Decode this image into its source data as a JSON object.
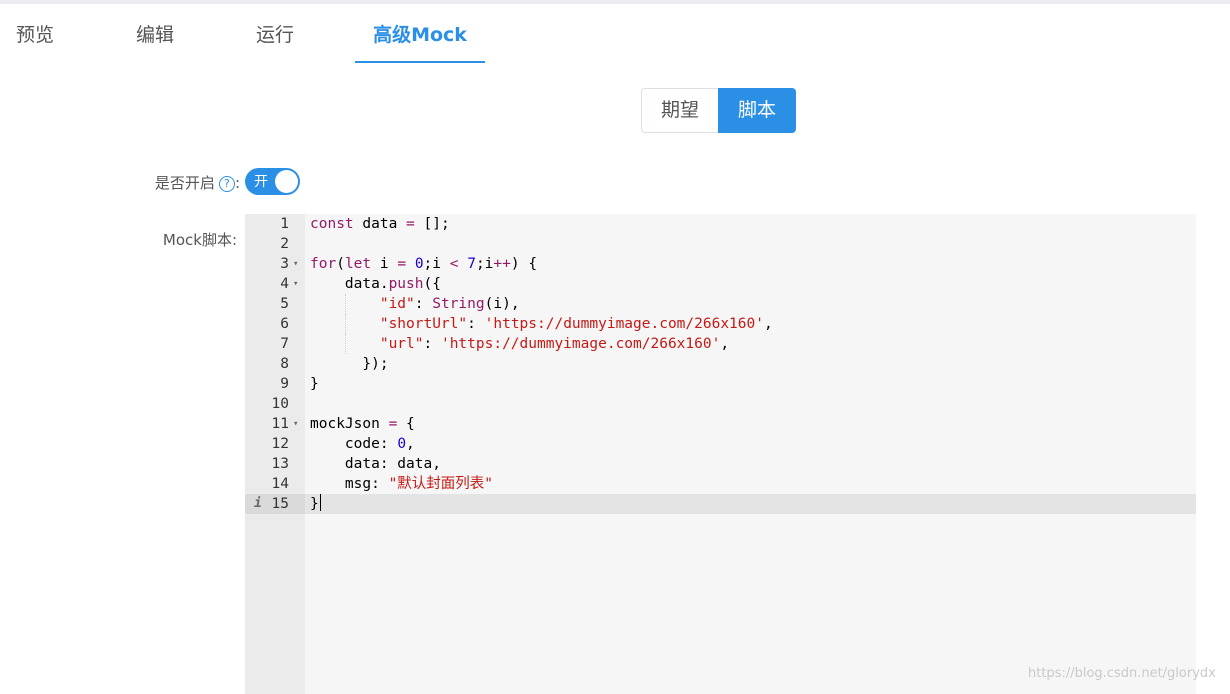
{
  "tabs": [
    {
      "label": "预览",
      "active": false
    },
    {
      "label": "编辑",
      "active": false
    },
    {
      "label": "运行",
      "active": false
    },
    {
      "label": "高级Mock",
      "active": true
    }
  ],
  "mode_toggle": {
    "left_label": "期望",
    "right_label": "脚本",
    "selected": "脚本"
  },
  "form": {
    "enable_label": "是否开启",
    "enable_colon": ":",
    "help_icon_glyph": "?",
    "switch_text": "开",
    "switch_on": true,
    "script_label": "Mock脚本:"
  },
  "editor": {
    "lines": [
      {
        "num": "1",
        "text": "const data = [];"
      },
      {
        "num": "2",
        "text": ""
      },
      {
        "num": "3",
        "text": "for(let i = 0;i < 7;i++) {"
      },
      {
        "num": "4",
        "text": "    data.push({"
      },
      {
        "num": "5",
        "text": "        \"id\": String(i),"
      },
      {
        "num": "6",
        "text": "        \"shortUrl\": 'https://dummyimage.com/266x160',"
      },
      {
        "num": "7",
        "text": "        \"url\": 'https://dummyimage.com/266x160',"
      },
      {
        "num": "8",
        "text": "      });"
      },
      {
        "num": "9",
        "text": "}"
      },
      {
        "num": "10",
        "text": ""
      },
      {
        "num": "11",
        "text": "mockJson = {"
      },
      {
        "num": "12",
        "text": "    code: 0,"
      },
      {
        "num": "13",
        "text": "    data: data,"
      },
      {
        "num": "14",
        "text": "    msg: \"默认封面列表\""
      },
      {
        "num": "15",
        "text": "}"
      }
    ],
    "fold_lines": [
      "3",
      "4",
      "11"
    ],
    "active_line": "15",
    "info_glyph": "i",
    "fold_glyph": "▾"
  },
  "watermark": "https://blog.csdn.net/glorydx",
  "colors": {
    "accent": "#2b8fe6",
    "keyword": "#931a68",
    "string": "#c41a16",
    "number": "#1c00cf"
  }
}
